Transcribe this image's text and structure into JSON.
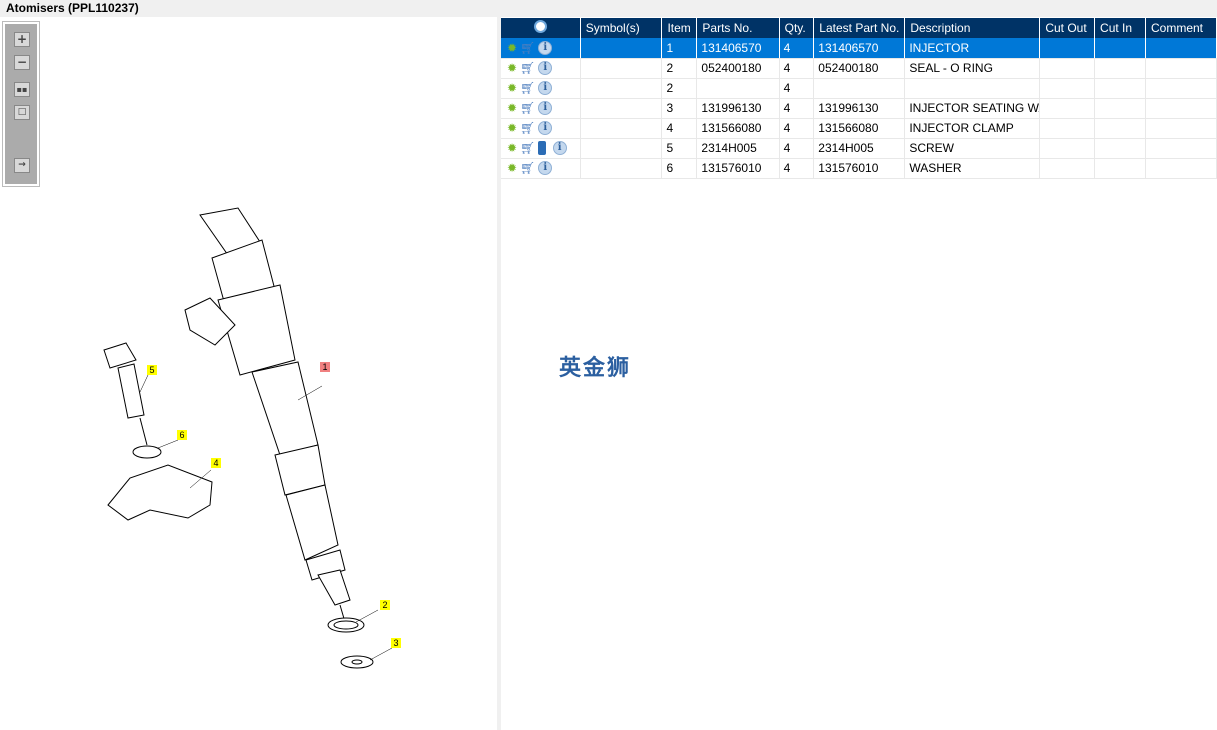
{
  "window": {
    "title": "Atomisers (PPL110237)"
  },
  "toolbar": {
    "zoom_in": "+",
    "zoom_out": "−"
  },
  "watermark": "英金狮",
  "grid": {
    "headers": [
      "",
      "Symbol(s)",
      "Item",
      "Parts No.",
      "Qty.",
      "Latest Part No.",
      "Description",
      "Cut Out",
      "Cut In",
      "Comment"
    ],
    "rows": [
      {
        "item": "1",
        "parts_no": "131406570",
        "qty": "4",
        "latest": "131406570",
        "desc": "INJECTOR",
        "book": false,
        "selected": true
      },
      {
        "item": "2",
        "parts_no": "052400180",
        "qty": "4",
        "latest": "052400180",
        "desc": "SEAL - O RING",
        "book": false
      },
      {
        "item": "2",
        "parts_no": "",
        "qty": "4",
        "latest": "",
        "desc": "",
        "book": false
      },
      {
        "item": "3",
        "parts_no": "131996130",
        "qty": "4",
        "latest": "131996130",
        "desc": "INJECTOR SEATING WASH",
        "book": false
      },
      {
        "item": "4",
        "parts_no": "131566080",
        "qty": "4",
        "latest": "131566080",
        "desc": "INJECTOR CLAMP",
        "book": false
      },
      {
        "item": "5",
        "parts_no": "2314H005",
        "qty": "4",
        "latest": "2314H005",
        "desc": "SCREW",
        "book": true
      },
      {
        "item": "6",
        "parts_no": "131576010",
        "qty": "4",
        "latest": "131576010",
        "desc": "WASHER",
        "book": false
      }
    ]
  },
  "callouts": [
    "1",
    "2",
    "3",
    "4",
    "5",
    "6"
  ]
}
